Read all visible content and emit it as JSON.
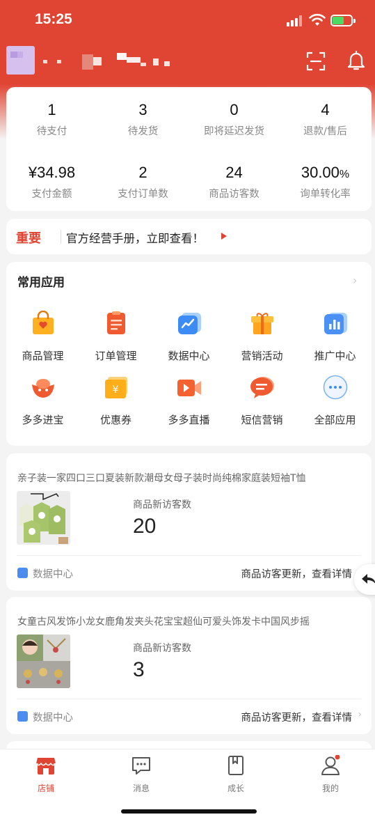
{
  "status_bar": {
    "time": "15:25"
  },
  "header": {
    "scan_icon": "scan-icon",
    "bell_icon": "bell-icon"
  },
  "stats": [
    {
      "value": "1",
      "label": "待支付"
    },
    {
      "value": "3",
      "label": "待发货"
    },
    {
      "value": "0",
      "label": "即将延迟发货"
    },
    {
      "value": "4",
      "label": "退款/售后"
    },
    {
      "value": "¥34.98",
      "label": "支付金额"
    },
    {
      "value": "2",
      "label": "支付订单数"
    },
    {
      "value": "24",
      "label": "商品访客数"
    },
    {
      "value": "30.00",
      "unit": "%",
      "label": "询单转化率"
    }
  ],
  "notice": {
    "tag": "重要",
    "text": "官方经营手册，立即查看！"
  },
  "apps": {
    "title": "常用应用",
    "items": [
      {
        "label": "商品管理",
        "icon": "shopping-bag-icon"
      },
      {
        "label": "订单管理",
        "icon": "order-list-icon"
      },
      {
        "label": "数据中心",
        "icon": "data-chart-icon"
      },
      {
        "label": "营销活动",
        "icon": "gift-box-icon"
      },
      {
        "label": "推广中心",
        "icon": "bar-chart-icon"
      },
      {
        "label": "多多进宝",
        "icon": "treasure-icon"
      },
      {
        "label": "优惠券",
        "icon": "coupon-icon"
      },
      {
        "label": "多多直播",
        "icon": "live-video-icon"
      },
      {
        "label": "短信营销",
        "icon": "sms-icon"
      },
      {
        "label": "全部应用",
        "icon": "more-apps-icon"
      }
    ]
  },
  "products": [
    {
      "title": "亲子装一家四口三口夏装新款潮母女母子装时尚纯棉家庭装短袖T恤",
      "metric_label": "商品新访客数",
      "metric_value": "20",
      "source": "数据中心",
      "link": "商品访客更新，查看详情"
    },
    {
      "title": "女童古风发饰小龙女鹿角发夹头花宝宝超仙可爱头饰发卡中国风步摇",
      "metric_label": "商品新访客数",
      "metric_value": "3",
      "source": "数据中心",
      "link": "商品访客更新，查看详情"
    }
  ],
  "tabbar": [
    {
      "label": "店铺",
      "icon": "store-icon",
      "active": true
    },
    {
      "label": "消息",
      "icon": "message-icon",
      "active": false
    },
    {
      "label": "成长",
      "icon": "book-icon",
      "active": false
    },
    {
      "label": "我的",
      "icon": "profile-icon",
      "active": false
    }
  ],
  "colors": {
    "brand": "#e04433",
    "background": "#f4f4f4"
  }
}
